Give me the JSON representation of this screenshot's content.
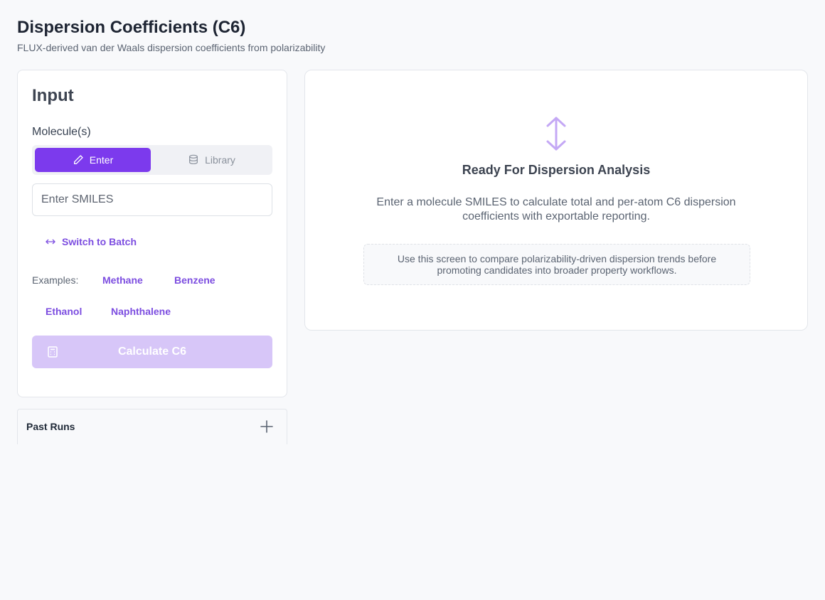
{
  "header": {
    "title": "Dispersion Coefficients (C6)",
    "subtitle": "FLUX-derived van der Waals dispersion coefficients from polarizability"
  },
  "input_panel": {
    "title": "Input",
    "molecule_label": "Molecule(s)",
    "tabs": [
      {
        "label": "Enter",
        "icon": "pencil-icon",
        "active": true
      },
      {
        "label": "Library",
        "icon": "database-icon",
        "active": false
      }
    ],
    "smiles_placeholder": "Enter SMILES",
    "smiles_value": "",
    "switch_batch_label": "Switch to Batch",
    "examples_label": "Examples:",
    "examples": [
      "Methane",
      "Benzene",
      "Ethanol",
      "Naphthalene"
    ],
    "calculate_label": "Calculate C6"
  },
  "past_runs": {
    "label": "Past Runs"
  },
  "result_panel": {
    "icon": "vertical-arrows-icon",
    "title": "Ready For Dispersion Analysis",
    "description": "Enter a molecule SMILES to calculate total and per-atom C6 dispersion coefficients with exportable reporting.",
    "hint": "Use this screen to compare polarizability-driven dispersion trends before promoting candidates into broader property workflows."
  },
  "colors": {
    "accent": "#7c3aed",
    "accent_text": "#7c4de0",
    "disabled_button": "#d7c6f8",
    "arrow_icon": "#c4a8f5"
  }
}
